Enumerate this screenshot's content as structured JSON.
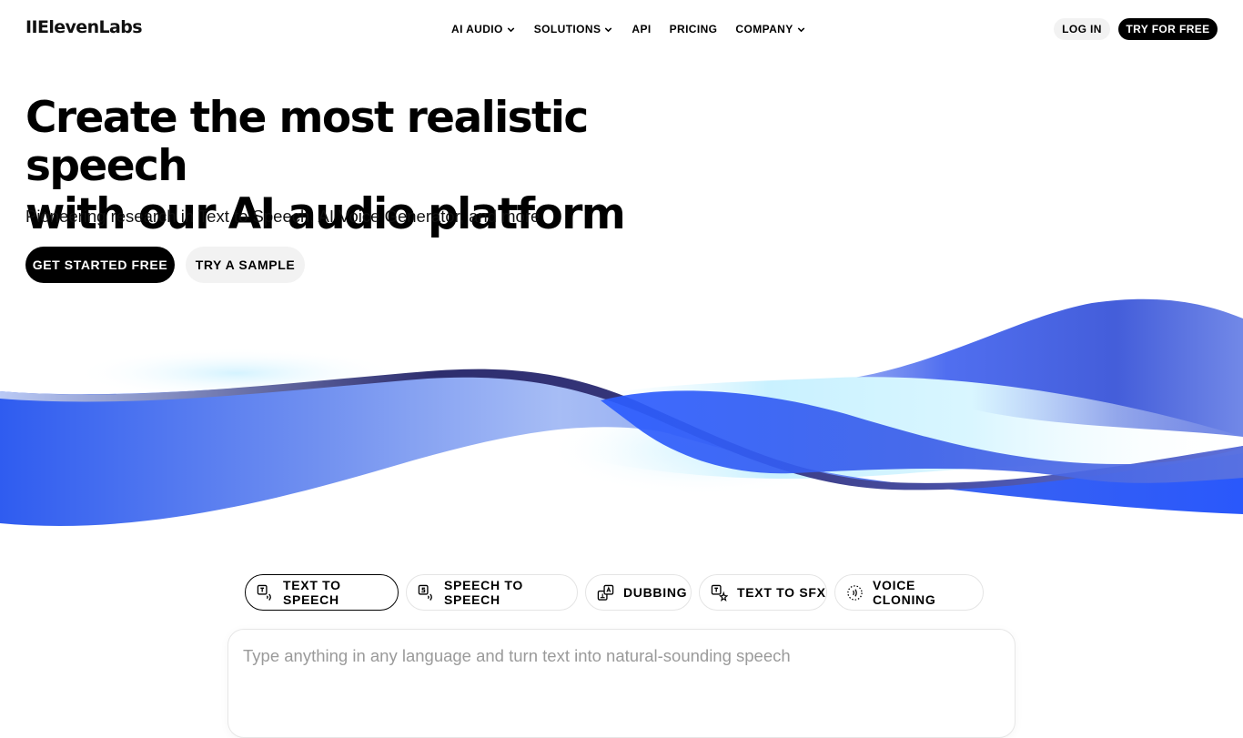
{
  "brand": {
    "logo": "IIElevenLabs"
  },
  "nav": {
    "links": [
      {
        "label": "AI AUDIO",
        "dropdown": true
      },
      {
        "label": "SOLUTIONS",
        "dropdown": true
      },
      {
        "label": "API",
        "dropdown": false
      },
      {
        "label": "PRICING",
        "dropdown": false
      },
      {
        "label": "COMPANY",
        "dropdown": true
      }
    ],
    "login": "LOG IN",
    "try_free": "TRY FOR FREE"
  },
  "hero": {
    "title_line1": "Create the most realistic speech",
    "title_line2": "with our AI audio platform",
    "subtitle": "Pioneering research in Text to Speech, AI Voice Generator, and more",
    "cta_primary": "GET STARTED FREE",
    "cta_secondary": "TRY A SAMPLE"
  },
  "tabs": [
    {
      "label": "TEXT TO SPEECH",
      "icon": "text-to-speech-icon",
      "active": true
    },
    {
      "label": "SPEECH TO SPEECH",
      "icon": "speech-to-speech-icon",
      "active": false
    },
    {
      "label": "DUBBING",
      "icon": "dubbing-icon",
      "active": false
    },
    {
      "label": "TEXT TO SFX",
      "icon": "text-to-sfx-icon",
      "active": false
    },
    {
      "label": "VOICE CLONING",
      "icon": "voice-cloning-icon",
      "active": false
    }
  ],
  "editor": {
    "placeholder": "Type anything in any language and turn text into natural-sounding speech",
    "value": ""
  },
  "colors": {
    "primary": "#000000",
    "secondary_button": "#f2f2f2",
    "wave_blue": "#2b5cff",
    "wave_light": "#a9c4f7",
    "wave_cyan": "#bdeeff",
    "wave_dark": "#2d2d6e"
  }
}
